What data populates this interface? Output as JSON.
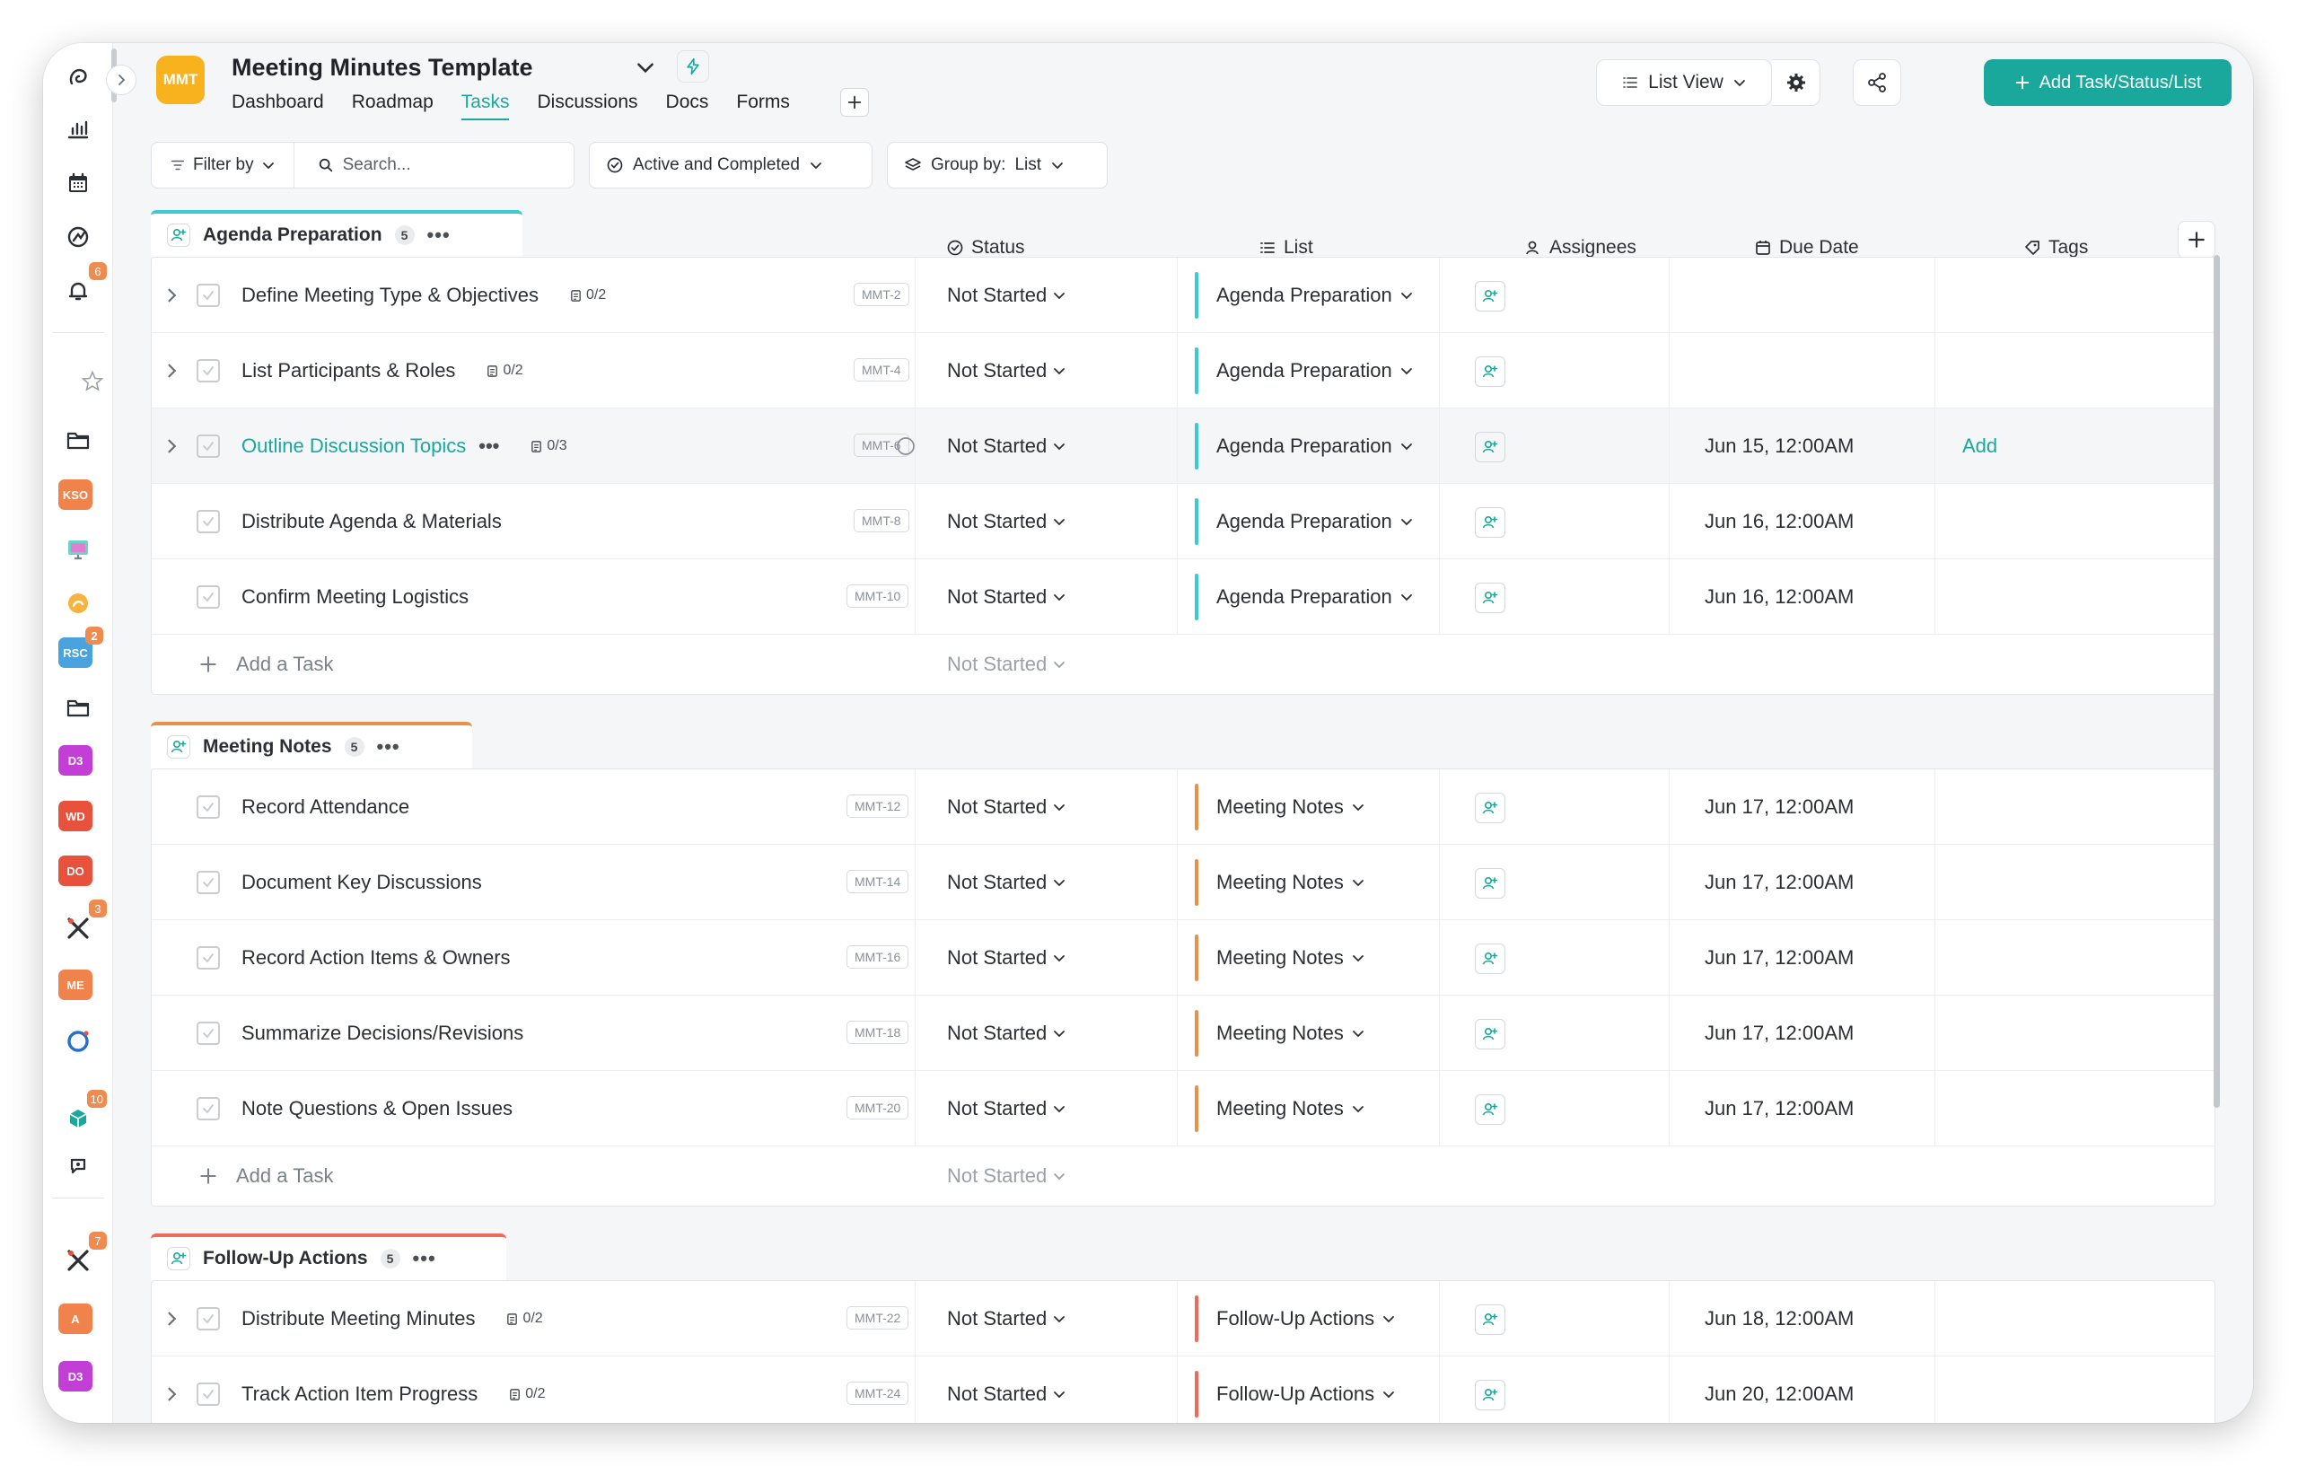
{
  "app": {
    "logo_text": "MMT",
    "title": "Meeting Minutes Template",
    "tabs": [
      "Dashboard",
      "Roadmap",
      "Tasks",
      "Discussions",
      "Docs",
      "Forms"
    ],
    "active_tab": "Tasks"
  },
  "header": {
    "view_label": "List View",
    "primary_button": "Add Task/Status/List"
  },
  "rail": {
    "badges": [
      {
        "text": "KSO",
        "color": "#f0824b"
      },
      {
        "text": "RSC",
        "color": "#4aa3df",
        "count": "2"
      },
      {
        "text": "D3",
        "color": "#c23fd6"
      },
      {
        "text": "WD",
        "color": "#e8513c"
      },
      {
        "text": "DO",
        "color": "#e8513c"
      },
      {
        "text": "ME",
        "color": "#f0824b"
      },
      {
        "text": "A",
        "color": "#f0824b"
      },
      {
        "text": "D3",
        "color": "#c23fd6"
      }
    ],
    "counts": {
      "notifications": "6",
      "tools_1": "3",
      "cube": "10",
      "tools_2": "7"
    }
  },
  "toolbar": {
    "filter_label": "Filter by",
    "search_placeholder": "Search...",
    "state_filter": "Active and Completed",
    "group_by_label": "Group by:",
    "group_by_value": "List"
  },
  "columns": {
    "status": "Status",
    "list": "List",
    "assignees": "Assignees",
    "due_date": "Due Date",
    "tags": "Tags"
  },
  "groups": [
    {
      "name": "Agenda Preparation",
      "count": "5",
      "color": "#3cc9d6",
      "add_task": "Add a Task",
      "add_status": "Not Started",
      "tasks": [
        {
          "name": "Define Meeting Type & Objectives",
          "sub": "0/2",
          "id": "MMT-2",
          "status": "Not Started",
          "list": "Agenda Preparation",
          "due": "",
          "tags": ""
        },
        {
          "name": "List Participants & Roles",
          "sub": "0/2",
          "id": "MMT-4",
          "status": "Not Started",
          "list": "Agenda Preparation",
          "due": "",
          "tags": ""
        },
        {
          "name": "Outline Discussion Topics",
          "sub": "0/3",
          "id": "MMT-6",
          "status": "Not Started",
          "list": "Agenda Preparation",
          "due": "Jun 15, 12:00AM",
          "tags": "Add"
        },
        {
          "name": "Distribute Agenda & Materials",
          "sub": "",
          "id": "MMT-8",
          "status": "Not Started",
          "list": "Agenda Preparation",
          "due": "Jun 16, 12:00AM",
          "tags": ""
        },
        {
          "name": "Confirm Meeting Logistics",
          "sub": "",
          "id": "MMT-10",
          "status": "Not Started",
          "list": "Agenda Preparation",
          "due": "Jun 16, 12:00AM",
          "tags": ""
        }
      ]
    },
    {
      "name": "Meeting Notes",
      "count": "5",
      "color": "#e8914a",
      "add_task": "Add a Task",
      "add_status": "Not Started",
      "tasks": [
        {
          "name": "Record Attendance",
          "sub": "",
          "id": "MMT-12",
          "status": "Not Started",
          "list": "Meeting Notes",
          "due": "Jun 17, 12:00AM",
          "tags": ""
        },
        {
          "name": "Document Key Discussions",
          "sub": "",
          "id": "MMT-14",
          "status": "Not Started",
          "list": "Meeting Notes",
          "due": "Jun 17, 12:00AM",
          "tags": ""
        },
        {
          "name": "Record Action Items & Owners",
          "sub": "",
          "id": "MMT-16",
          "status": "Not Started",
          "list": "Meeting Notes",
          "due": "Jun 17, 12:00AM",
          "tags": ""
        },
        {
          "name": "Summarize Decisions/Revisions",
          "sub": "",
          "id": "MMT-18",
          "status": "Not Started",
          "list": "Meeting Notes",
          "due": "Jun 17, 12:00AM",
          "tags": ""
        },
        {
          "name": "Note Questions & Open Issues",
          "sub": "",
          "id": "MMT-20",
          "status": "Not Started",
          "list": "Meeting Notes",
          "due": "Jun 17, 12:00AM",
          "tags": ""
        }
      ]
    },
    {
      "name": "Follow-Up Actions",
      "count": "5",
      "color": "#ef6a5a",
      "add_task": "",
      "add_status": "",
      "tasks": [
        {
          "name": "Distribute Meeting Minutes",
          "sub": "0/2",
          "id": "MMT-22",
          "status": "Not Started",
          "list": "Follow-Up Actions",
          "due": "Jun 18, 12:00AM",
          "tags": ""
        },
        {
          "name": "Track Action Item Progress",
          "sub": "0/2",
          "id": "MMT-24",
          "status": "Not Started",
          "list": "Follow-Up Actions",
          "due": "Jun 20, 12:00AM",
          "tags": ""
        }
      ]
    }
  ]
}
